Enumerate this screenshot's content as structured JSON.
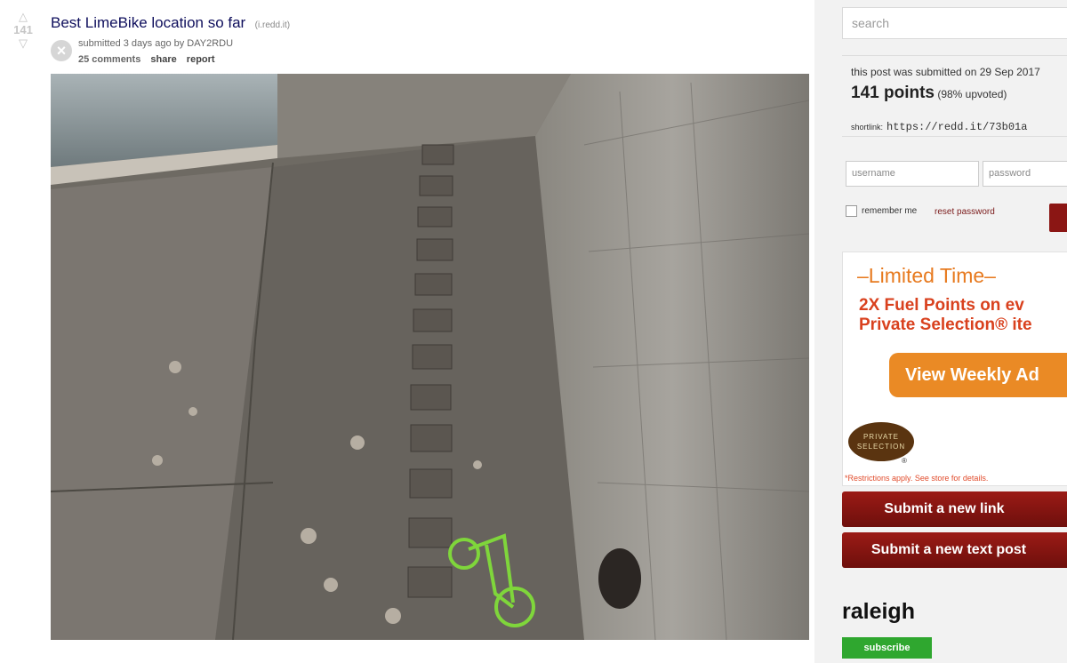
{
  "post": {
    "score": "141",
    "title": "Best LimeBike location so far",
    "domain": "(i.redd.it)",
    "tagline": "submitted 3 days ago by DAY2RDU",
    "comments": "25 comments",
    "share": "share",
    "report": "report",
    "thumb_icon": "close-icon"
  },
  "sidebar": {
    "search_placeholder": "search",
    "submitted_on": "this post was submitted on 29 Sep 2017",
    "points": "141 points",
    "upvoted": "(98% upvoted)",
    "shortlink_label": "shortlink:",
    "shortlink_url": "https://redd.it/73b01a",
    "username_placeholder": "username",
    "password_placeholder": "password",
    "remember_me": "remember me",
    "reset_password": "reset password",
    "submit_link": "Submit a new link",
    "submit_text": "Submit a new text post",
    "subreddit": "raleigh",
    "subscribe": "subscribe"
  },
  "ad": {
    "limited_time": "–Limited Time–",
    "fuel_line1": "2X Fuel Points on ev",
    "fuel_line2": "Private Selection® ite",
    "view_weekly": "View Weekly Ad",
    "logo_text": "PRIVATE SELECTION",
    "registered": "®",
    "restrictions": "*Restrictions apply. See store for details."
  },
  "colors": {
    "title": "#0e0e5c",
    "submit_button": "#8b1614",
    "subscribe": "#2fa72f",
    "ad_orange": "#ea8a25"
  }
}
